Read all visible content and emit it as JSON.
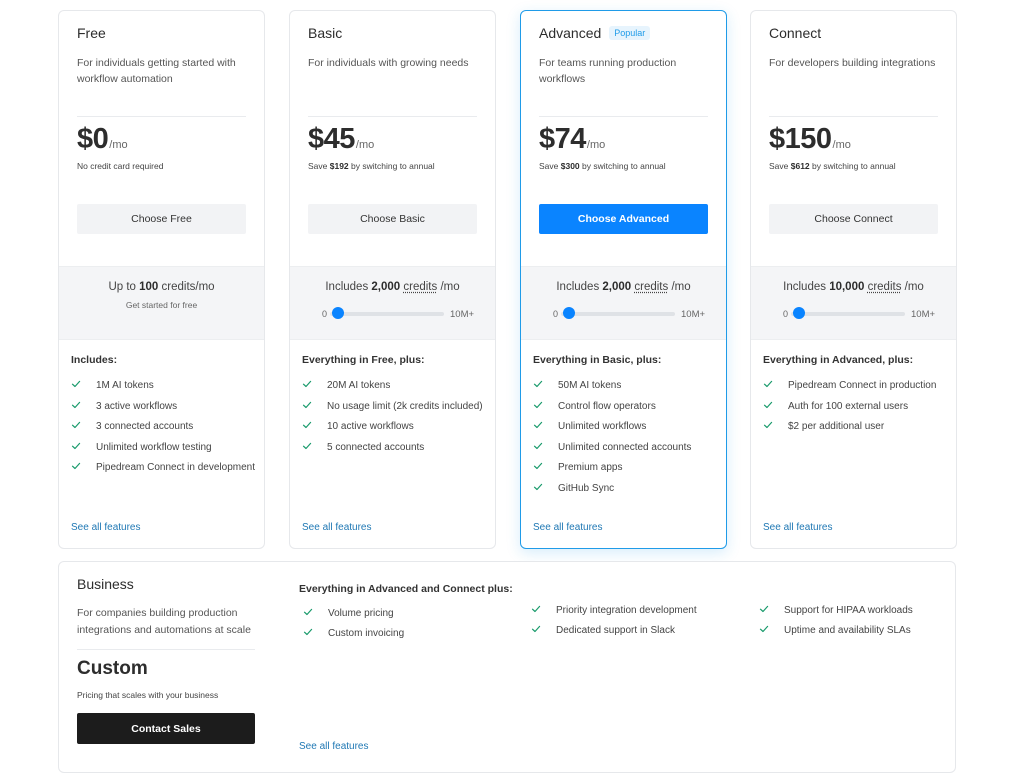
{
  "plans": [
    {
      "name": "Free",
      "description": "For individuals getting started with workflow automation",
      "price": "$0",
      "unit": "/mo",
      "note": "No credit card required",
      "cta": "Choose Free",
      "credits_prefix": "Up to ",
      "credits_amount": "100",
      "credits_word": "credits",
      "credits_suffix": "/mo",
      "credits_sub": "Get started for free",
      "includes_title": "Includes:",
      "features": [
        "1M AI tokens",
        "3 active workflows",
        "3 connected accounts",
        "Unlimited workflow testing",
        "Pipedream Connect in development"
      ],
      "see_all": "See all features"
    },
    {
      "name": "Basic",
      "description": "For individuals with growing needs",
      "price": "$45",
      "unit": "/mo",
      "note_prefix": "Save ",
      "note_amount": "$192",
      "note_suffix": " by switching to annual",
      "cta": "Choose Basic",
      "credits_prefix": "Includes ",
      "credits_amount": "2,000",
      "credits_word": "credits",
      "credits_suffix": " /mo",
      "slider_min": "0",
      "slider_max": "10M+",
      "slider_value": 0.02,
      "includes_title": "Everything in Free, plus:",
      "features": [
        "20M AI tokens",
        "No usage limit (2k credits included)",
        "10 active workflows",
        "5 connected accounts"
      ],
      "see_all": "See all features"
    },
    {
      "name": "Advanced",
      "badge": "Popular",
      "description": "For teams running production workflows",
      "price": "$74",
      "unit": "/mo",
      "note_prefix": "Save ",
      "note_amount": "$300",
      "note_suffix": " by switching to annual",
      "cta": "Choose Advanced",
      "credits_prefix": "Includes ",
      "credits_amount": "2,000",
      "credits_word": "credits",
      "credits_suffix": " /mo",
      "slider_min": "0",
      "slider_max": "10M+",
      "slider_value": 0.02,
      "includes_title": "Everything in Basic, plus:",
      "features": [
        "50M AI tokens",
        "Control flow operators",
        "Unlimited workflows",
        "Unlimited connected accounts",
        "Premium apps",
        "GitHub Sync"
      ],
      "see_all": "See all features"
    },
    {
      "name": "Connect",
      "description": "For developers building integrations",
      "price": "$150",
      "unit": "/mo",
      "note_prefix": "Save ",
      "note_amount": "$612",
      "note_suffix": " by switching to annual",
      "cta": "Choose Connect",
      "credits_prefix": "Includes ",
      "credits_amount": "10,000",
      "credits_word": "credits",
      "credits_suffix": " /mo",
      "slider_min": "0",
      "slider_max": "10M+",
      "slider_value": 0.02,
      "includes_title": "Everything in Advanced, plus:",
      "features": [
        "Pipedream Connect in production",
        "Auth for 100 external users",
        "$2 per additional user"
      ],
      "see_all": "See all features"
    }
  ],
  "business": {
    "name": "Business",
    "description": "For companies building production integrations and automations at scale",
    "price": "Custom",
    "note": "Pricing that scales with your business",
    "cta": "Contact Sales",
    "includes_title": "Everything in Advanced and Connect plus:",
    "columns": [
      [
        "Volume pricing",
        "Custom invoicing"
      ],
      [
        "Priority integration development",
        "Dedicated support in Slack"
      ],
      [
        "Support for HIPAA workloads",
        "Uptime and availability SLAs"
      ]
    ],
    "see_all": "See all features"
  },
  "colors": {
    "accent": "#0a84ff",
    "check": "#1a9b6c",
    "link": "#1f78b4",
    "highlight_border": "#1f9be8"
  },
  "icons": {
    "feature_check": "check-icon"
  }
}
